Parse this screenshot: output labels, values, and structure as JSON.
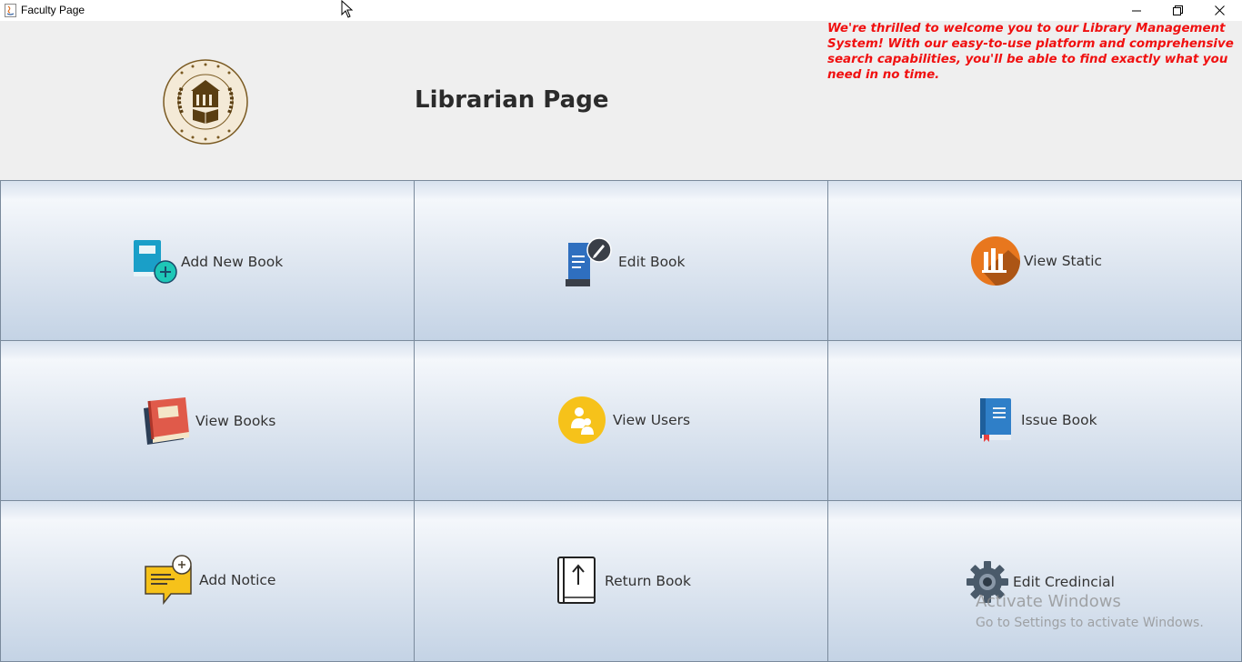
{
  "window": {
    "title": "Faculty Page",
    "controls": [
      "minimize-icon",
      "maximize-icon",
      "close-icon"
    ]
  },
  "header": {
    "logo_text": "COLLEGE NAME & Co.",
    "page_title": "Librarian Page",
    "welcome_message": "We're thrilled to welcome you to our Library Management System! With our easy-to-use platform and comprehensive search capabilities, you'll be able to find exactly what you need in no time."
  },
  "tiles": [
    {
      "label": "Add New Book",
      "icon": "add-book-icon"
    },
    {
      "label": "Edit Book",
      "icon": "edit-book-icon"
    },
    {
      "label": "View Static",
      "icon": "statistics-icon"
    },
    {
      "label": "View Books",
      "icon": "books-icon"
    },
    {
      "label": "View Users",
      "icon": "users-icon"
    },
    {
      "label": "Issue Book",
      "icon": "issue-book-icon"
    },
    {
      "label": "Add Notice",
      "icon": "notice-icon"
    },
    {
      "label": "Return Book",
      "icon": "return-book-icon"
    },
    {
      "label": "Edit Credincial",
      "icon": "gear-icon"
    }
  ],
  "watermark": {
    "line1": "Activate Windows",
    "line2": "Go to Settings to activate Windows."
  },
  "colors": {
    "welcome_text": "#f01010",
    "header_bg": "#efefef",
    "tile_border": "#7a8a9c"
  }
}
